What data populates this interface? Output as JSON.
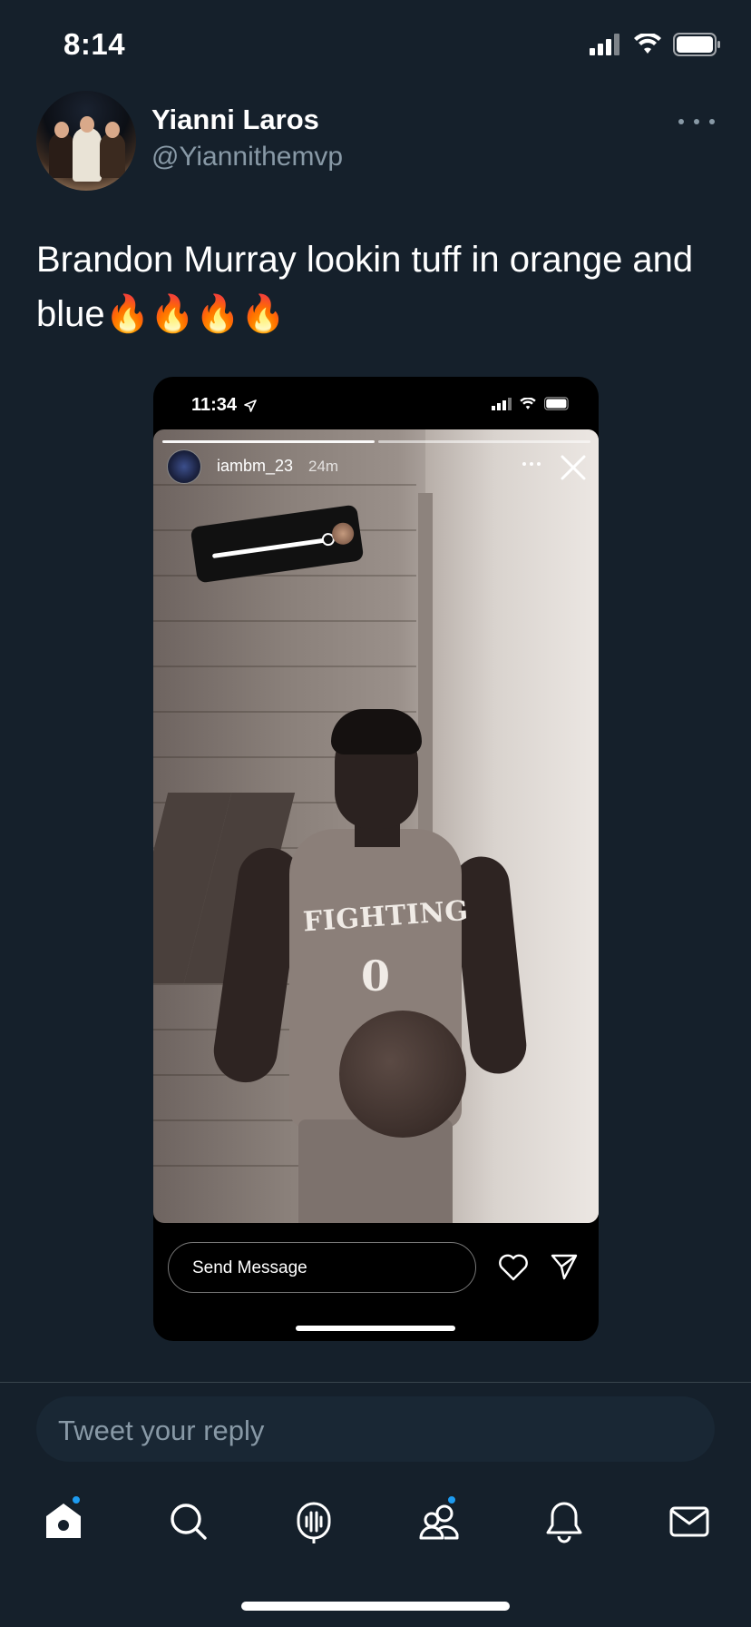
{
  "status_bar": {
    "time": "8:14"
  },
  "tweet": {
    "author_name": "Yianni Laros",
    "author_handle": "@Yiannithemvp",
    "text": "Brandon Murray lookin tuff in orange and blue",
    "emojis": "🔥🔥🔥🔥"
  },
  "story_screenshot": {
    "time": "11:34",
    "username": "iambm_23",
    "age": "24m",
    "jersey_text": "FIGHTING",
    "jersey_number": "0",
    "message_placeholder": "Send Message"
  },
  "reply": {
    "placeholder": "Tweet your reply"
  },
  "tab_bar": {
    "items": [
      {
        "name": "home",
        "icon": "home-icon",
        "badge": true
      },
      {
        "name": "search",
        "icon": "search-icon",
        "badge": false
      },
      {
        "name": "spaces",
        "icon": "spaces-icon",
        "badge": false
      },
      {
        "name": "communities",
        "icon": "communities-icon",
        "badge": true
      },
      {
        "name": "notifications",
        "icon": "bell-icon",
        "badge": false
      },
      {
        "name": "messages",
        "icon": "mail-icon",
        "badge": false
      }
    ]
  },
  "colors": {
    "background": "#15202b",
    "secondary_text": "#8899a6",
    "accent": "#1d9bf0",
    "divider": "#38444d"
  }
}
